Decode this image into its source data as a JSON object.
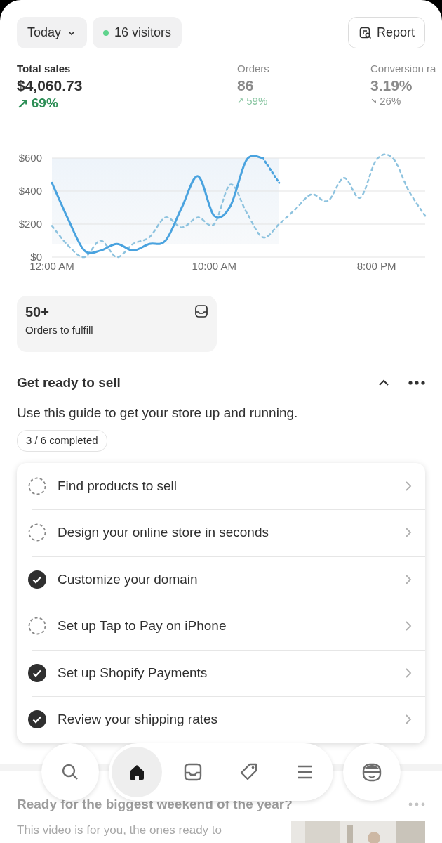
{
  "toolbar": {
    "period": "Today",
    "visitors": "16 visitors",
    "live": true,
    "report": "Report"
  },
  "metrics": [
    {
      "label": "Total sales",
      "value": "$4,060.73",
      "arrow": "↗",
      "change": "69%",
      "selected": true
    },
    {
      "label": "Orders",
      "value": "86",
      "arrow": "↗",
      "change": "59%",
      "selected": false
    },
    {
      "label": "Conversion ra",
      "value": "3.19%",
      "arrow": "↘",
      "change": "26%",
      "selected": false
    }
  ],
  "chart_data": {
    "type": "line",
    "x": [
      0,
      1,
      2,
      3,
      4,
      5,
      6,
      7,
      8,
      9,
      10,
      11,
      12,
      13,
      14,
      15,
      16,
      17,
      18,
      19,
      20,
      21,
      22,
      23
    ],
    "xlim": [
      0,
      23
    ],
    "xticks": [
      {
        "value": 0,
        "label": "12:00 AM"
      },
      {
        "value": 10,
        "label": "10:00 AM"
      },
      {
        "value": 20,
        "label": "8:00 PM"
      }
    ],
    "ylim": [
      0,
      600
    ],
    "yticks": [
      {
        "value": 0,
        "label": "$0"
      },
      {
        "value": 200,
        "label": "$200"
      },
      {
        "value": 400,
        "label": "$400"
      },
      {
        "value": 600,
        "label": "$600"
      }
    ],
    "series": [
      {
        "color": "#4aa3df",
        "line_style": "solid",
        "values": [
          450,
          230,
          40,
          40,
          80,
          40,
          80,
          100,
          300,
          490,
          250,
          310,
          590,
          600,
          null,
          null,
          null,
          null,
          null,
          null,
          null,
          null,
          null,
          null
        ]
      },
      {
        "color": "#4aa3df",
        "line_style": "dotted",
        "values": [
          null,
          null,
          null,
          null,
          null,
          null,
          null,
          null,
          null,
          null,
          null,
          null,
          null,
          600,
          450,
          null,
          null,
          null,
          null,
          null,
          null,
          null,
          null,
          null
        ]
      },
      {
        "color": "#8ec3df",
        "line_style": "dashed",
        "values": [
          190,
          70,
          0,
          100,
          0,
          80,
          120,
          240,
          180,
          240,
          200,
          440,
          270,
          120,
          200,
          290,
          380,
          340,
          480,
          360,
          590,
          600,
          400,
          250
        ]
      }
    ]
  },
  "fulfill": {
    "value": "50+",
    "label": "Orders to fulfill"
  },
  "guide": {
    "title": "Get ready to sell",
    "expanded": true,
    "description": "Use this guide to get your store up and running.",
    "progress": "3 / 6 completed",
    "tasks": [
      {
        "label": "Find products to sell",
        "checked": false
      },
      {
        "label": "Design your online store in seconds",
        "checked": false
      },
      {
        "label": "Customize your domain",
        "checked": true
      },
      {
        "label": "Set up Tap to Pay on iPhone",
        "checked": false
      },
      {
        "label": "Set up Shopify Payments",
        "checked": true
      },
      {
        "label": "Review your shipping rates",
        "checked": true
      }
    ]
  },
  "promo": {
    "title": "Ready for the biggest weekend of the year?",
    "text": "This video is for you, the ones ready to"
  },
  "nav": [
    {
      "kind": "search",
      "selected": false
    },
    {
      "kind": "home",
      "selected": true
    },
    {
      "kind": "inbox",
      "selected": false
    },
    {
      "kind": "tag",
      "selected": false
    },
    {
      "kind": "menu",
      "selected": false
    },
    {
      "kind": "avatar",
      "selected": false
    }
  ]
}
